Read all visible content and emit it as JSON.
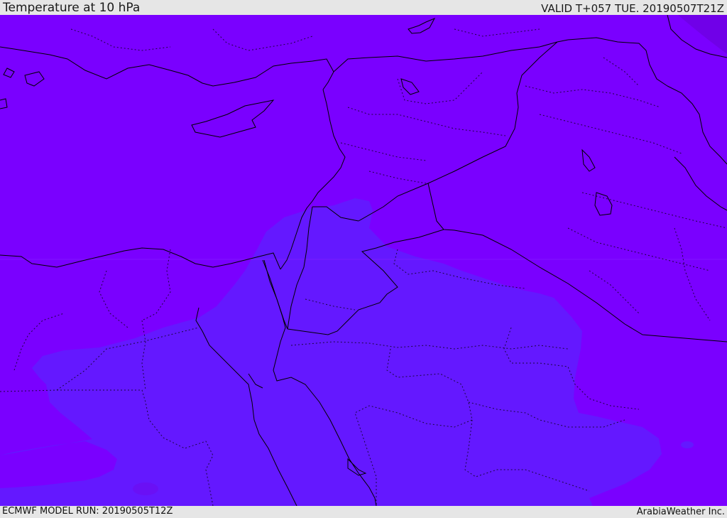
{
  "header": {
    "title": "Temperature at 10 hPa",
    "valid": "VALID T+057 TUE. 20190507T21Z"
  },
  "footer": {
    "model_run": "ECMWF MODEL RUN: 20190505T12Z",
    "credit": "ArabiaWeather Inc."
  },
  "map": {
    "colors": {
      "background_field": "#7a00ff",
      "warm_zone": "#6418ff",
      "corner_patch": "#7000e8",
      "coastline": "#000000"
    },
    "icons": [
      "temperature-field-map"
    ]
  }
}
